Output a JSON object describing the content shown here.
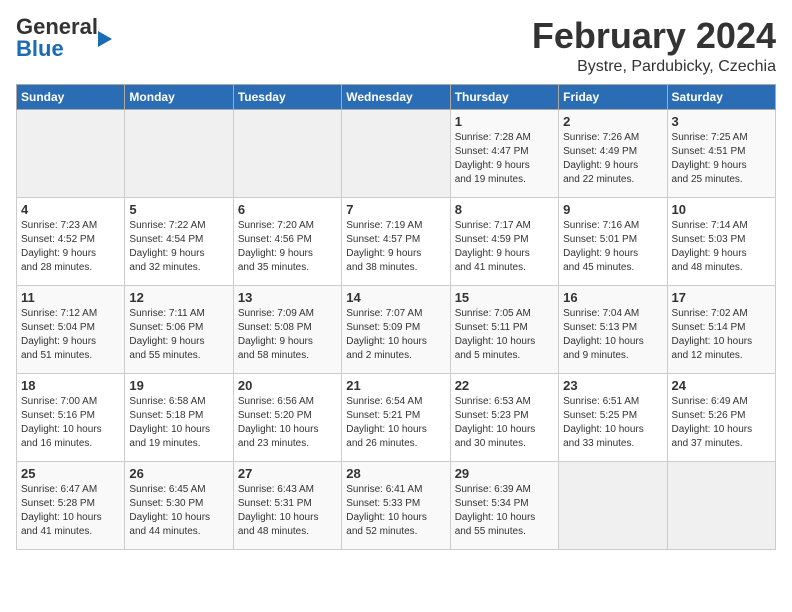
{
  "logo": {
    "general": "General",
    "blue": "Blue"
  },
  "title": "February 2024",
  "location": "Bystre, Pardubicky, Czechia",
  "days_of_week": [
    "Sunday",
    "Monday",
    "Tuesday",
    "Wednesday",
    "Thursday",
    "Friday",
    "Saturday"
  ],
  "weeks": [
    [
      {
        "day": "",
        "info": ""
      },
      {
        "day": "",
        "info": ""
      },
      {
        "day": "",
        "info": ""
      },
      {
        "day": "",
        "info": ""
      },
      {
        "day": "1",
        "info": "Sunrise: 7:28 AM\nSunset: 4:47 PM\nDaylight: 9 hours\nand 19 minutes."
      },
      {
        "day": "2",
        "info": "Sunrise: 7:26 AM\nSunset: 4:49 PM\nDaylight: 9 hours\nand 22 minutes."
      },
      {
        "day": "3",
        "info": "Sunrise: 7:25 AM\nSunset: 4:51 PM\nDaylight: 9 hours\nand 25 minutes."
      }
    ],
    [
      {
        "day": "4",
        "info": "Sunrise: 7:23 AM\nSunset: 4:52 PM\nDaylight: 9 hours\nand 28 minutes."
      },
      {
        "day": "5",
        "info": "Sunrise: 7:22 AM\nSunset: 4:54 PM\nDaylight: 9 hours\nand 32 minutes."
      },
      {
        "day": "6",
        "info": "Sunrise: 7:20 AM\nSunset: 4:56 PM\nDaylight: 9 hours\nand 35 minutes."
      },
      {
        "day": "7",
        "info": "Sunrise: 7:19 AM\nSunset: 4:57 PM\nDaylight: 9 hours\nand 38 minutes."
      },
      {
        "day": "8",
        "info": "Sunrise: 7:17 AM\nSunset: 4:59 PM\nDaylight: 9 hours\nand 41 minutes."
      },
      {
        "day": "9",
        "info": "Sunrise: 7:16 AM\nSunset: 5:01 PM\nDaylight: 9 hours\nand 45 minutes."
      },
      {
        "day": "10",
        "info": "Sunrise: 7:14 AM\nSunset: 5:03 PM\nDaylight: 9 hours\nand 48 minutes."
      }
    ],
    [
      {
        "day": "11",
        "info": "Sunrise: 7:12 AM\nSunset: 5:04 PM\nDaylight: 9 hours\nand 51 minutes."
      },
      {
        "day": "12",
        "info": "Sunrise: 7:11 AM\nSunset: 5:06 PM\nDaylight: 9 hours\nand 55 minutes."
      },
      {
        "day": "13",
        "info": "Sunrise: 7:09 AM\nSunset: 5:08 PM\nDaylight: 9 hours\nand 58 minutes."
      },
      {
        "day": "14",
        "info": "Sunrise: 7:07 AM\nSunset: 5:09 PM\nDaylight: 10 hours\nand 2 minutes."
      },
      {
        "day": "15",
        "info": "Sunrise: 7:05 AM\nSunset: 5:11 PM\nDaylight: 10 hours\nand 5 minutes."
      },
      {
        "day": "16",
        "info": "Sunrise: 7:04 AM\nSunset: 5:13 PM\nDaylight: 10 hours\nand 9 minutes."
      },
      {
        "day": "17",
        "info": "Sunrise: 7:02 AM\nSunset: 5:14 PM\nDaylight: 10 hours\nand 12 minutes."
      }
    ],
    [
      {
        "day": "18",
        "info": "Sunrise: 7:00 AM\nSunset: 5:16 PM\nDaylight: 10 hours\nand 16 minutes."
      },
      {
        "day": "19",
        "info": "Sunrise: 6:58 AM\nSunset: 5:18 PM\nDaylight: 10 hours\nand 19 minutes."
      },
      {
        "day": "20",
        "info": "Sunrise: 6:56 AM\nSunset: 5:20 PM\nDaylight: 10 hours\nand 23 minutes."
      },
      {
        "day": "21",
        "info": "Sunrise: 6:54 AM\nSunset: 5:21 PM\nDaylight: 10 hours\nand 26 minutes."
      },
      {
        "day": "22",
        "info": "Sunrise: 6:53 AM\nSunset: 5:23 PM\nDaylight: 10 hours\nand 30 minutes."
      },
      {
        "day": "23",
        "info": "Sunrise: 6:51 AM\nSunset: 5:25 PM\nDaylight: 10 hours\nand 33 minutes."
      },
      {
        "day": "24",
        "info": "Sunrise: 6:49 AM\nSunset: 5:26 PM\nDaylight: 10 hours\nand 37 minutes."
      }
    ],
    [
      {
        "day": "25",
        "info": "Sunrise: 6:47 AM\nSunset: 5:28 PM\nDaylight: 10 hours\nand 41 minutes."
      },
      {
        "day": "26",
        "info": "Sunrise: 6:45 AM\nSunset: 5:30 PM\nDaylight: 10 hours\nand 44 minutes."
      },
      {
        "day": "27",
        "info": "Sunrise: 6:43 AM\nSunset: 5:31 PM\nDaylight: 10 hours\nand 48 minutes."
      },
      {
        "day": "28",
        "info": "Sunrise: 6:41 AM\nSunset: 5:33 PM\nDaylight: 10 hours\nand 52 minutes."
      },
      {
        "day": "29",
        "info": "Sunrise: 6:39 AM\nSunset: 5:34 PM\nDaylight: 10 hours\nand 55 minutes."
      },
      {
        "day": "",
        "info": ""
      },
      {
        "day": "",
        "info": ""
      }
    ]
  ]
}
